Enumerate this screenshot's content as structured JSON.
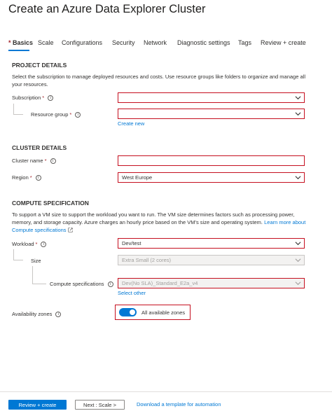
{
  "header": {
    "title": "Create an Azure Data Explorer Cluster",
    "more_label": "···"
  },
  "tabs": [
    {
      "label": "Basics",
      "required_marker": "*",
      "active": true
    },
    {
      "label": "Scale"
    },
    {
      "label": "Configurations"
    },
    {
      "label": "Security"
    },
    {
      "label": "Network"
    },
    {
      "label": "Diagnostic settings"
    },
    {
      "label": "Tags"
    },
    {
      "label": "Review + create"
    }
  ],
  "project": {
    "heading": "PROJECT DETAILS",
    "description": "Select the subscription to manage deployed resources and costs. Use resource groups like folders to organize and manage all your resources.",
    "subscription_label": "Subscription",
    "subscription_value": "",
    "resource_group_label": "Resource group",
    "resource_group_value": "",
    "create_new": "Create new"
  },
  "cluster": {
    "heading": "CLUSTER DETAILS",
    "name_label": "Cluster name",
    "name_value": "",
    "region_label": "Region",
    "region_value": "West Europe"
  },
  "compute": {
    "heading": "COMPUTE SPECIFICATION",
    "description": "To support a VM size to support the workload you want to run. The VM size determines factors such as processing power, memory, and storage capacity. Azure charges an hourly price based on the VM's size and operating system.",
    "learn_more": "Learn more about Compute specifications",
    "workload_label": "Workload",
    "workload_value": "Dev/test",
    "size_label": "Size",
    "size_value": "Extra Small (2 cores)",
    "spec_label": "Compute specifications",
    "spec_value": "Dev(No SLA)_Standard_E2a_v4",
    "select_other": "Select other"
  },
  "availability": {
    "label": "Availability zones",
    "toggle_label": "All available zones",
    "enabled": true
  },
  "footer": {
    "review_create": "Review + create",
    "next": "Next : Scale >",
    "download": "Download a template for automation"
  },
  "colors": {
    "accent": "#0078d4",
    "error_outline": "#c50f1f",
    "required": "#a4262c"
  },
  "icons": [
    "info-icon",
    "chevron-down-icon",
    "external-link-icon"
  ]
}
